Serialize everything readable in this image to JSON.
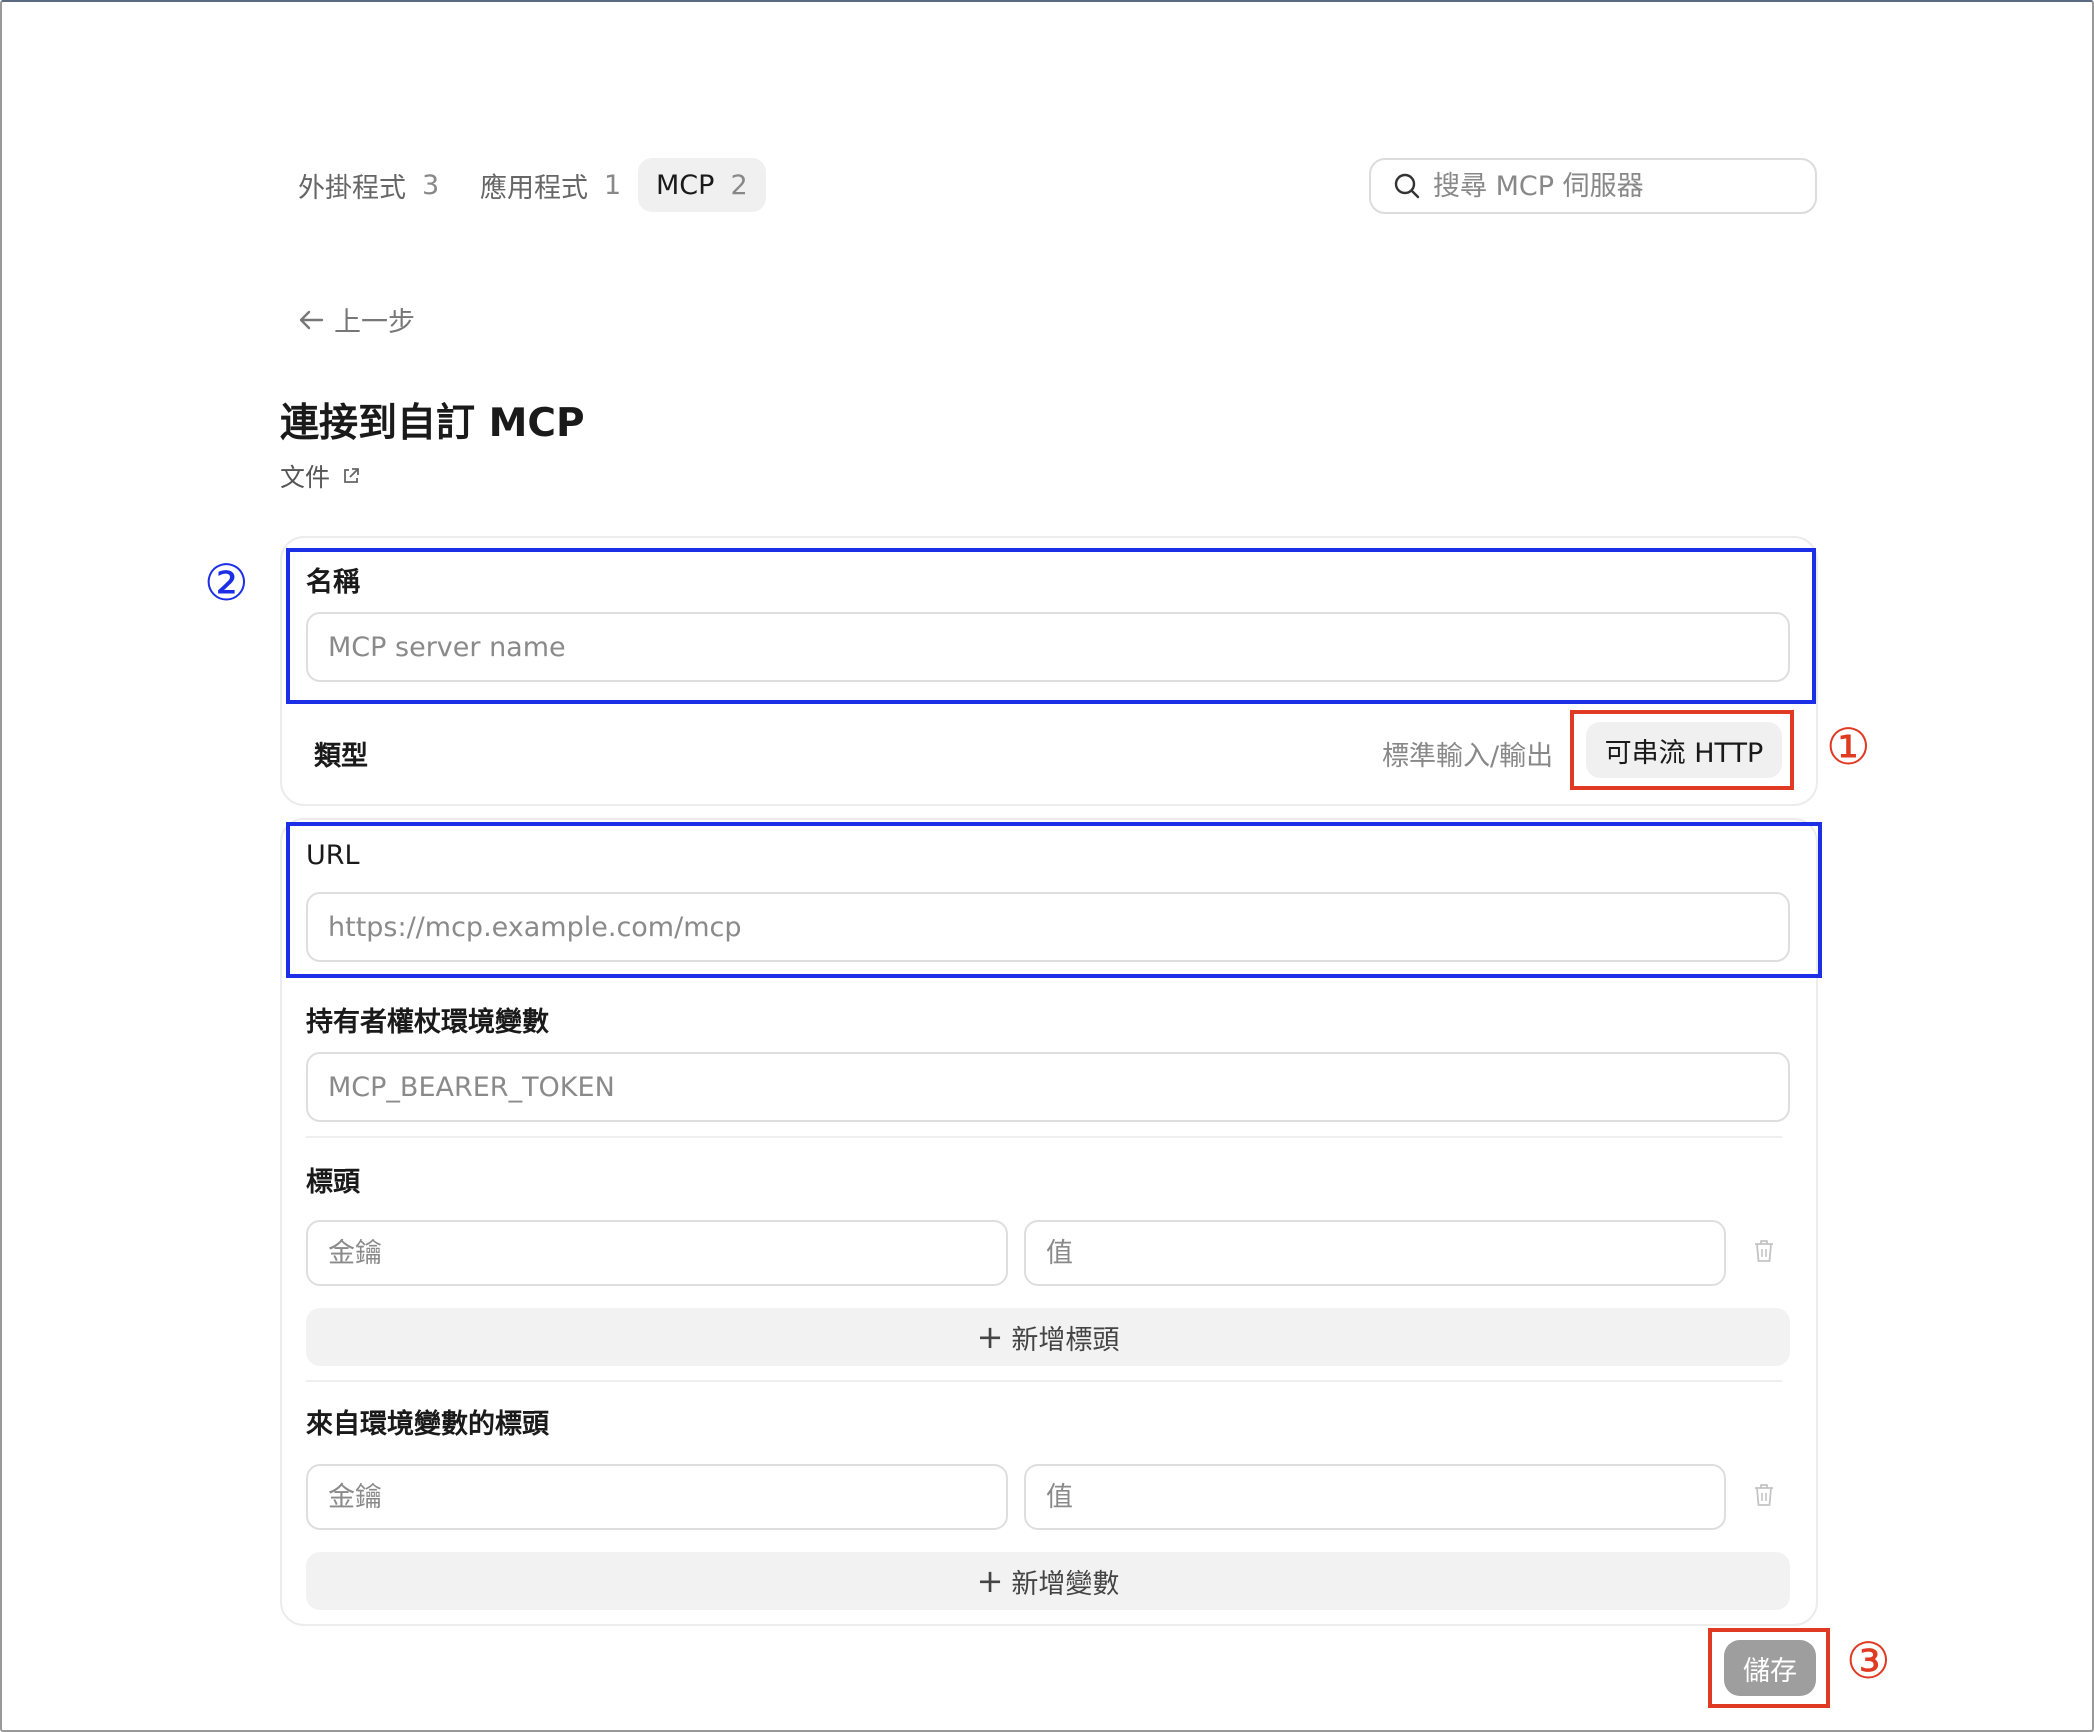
{
  "tabs": [
    {
      "label": "外掛程式",
      "count": "3"
    },
    {
      "label": "應用程式",
      "count": "1"
    },
    {
      "label": "MCP",
      "count": "2"
    }
  ],
  "search": {
    "placeholder": "搜尋 MCP 伺服器"
  },
  "back_label": "上一步",
  "page_title": "連接到自訂 MCP",
  "docs_link": "文件",
  "form": {
    "name": {
      "label": "名稱",
      "placeholder": "MCP server name",
      "value": ""
    },
    "type": {
      "label": "類型",
      "options": [
        "標準輸入/輸出",
        "可串流 HTTP"
      ],
      "selected": "可串流 HTTP"
    },
    "url": {
      "label": "URL",
      "placeholder": "https://mcp.example.com/mcp",
      "value": ""
    },
    "bearer": {
      "label": "持有者權杖環境變數",
      "placeholder": "MCP_BEARER_TOKEN",
      "value": ""
    },
    "headers": {
      "label": "標頭",
      "key_placeholder": "金鑰",
      "value_placeholder": "值",
      "add_label": "新增標頭"
    },
    "env_headers": {
      "label": "來自環境變數的標頭",
      "key_placeholder": "金鑰",
      "value_placeholder": "值",
      "add_label": "新增變數"
    }
  },
  "save_label": "儲存",
  "annotations": {
    "one": "①",
    "two": "②",
    "three": "③"
  },
  "colors": {
    "annotation_blue": "#1c2fe6",
    "annotation_red": "#e03b22",
    "save_disabled": "#9e9e9e"
  }
}
